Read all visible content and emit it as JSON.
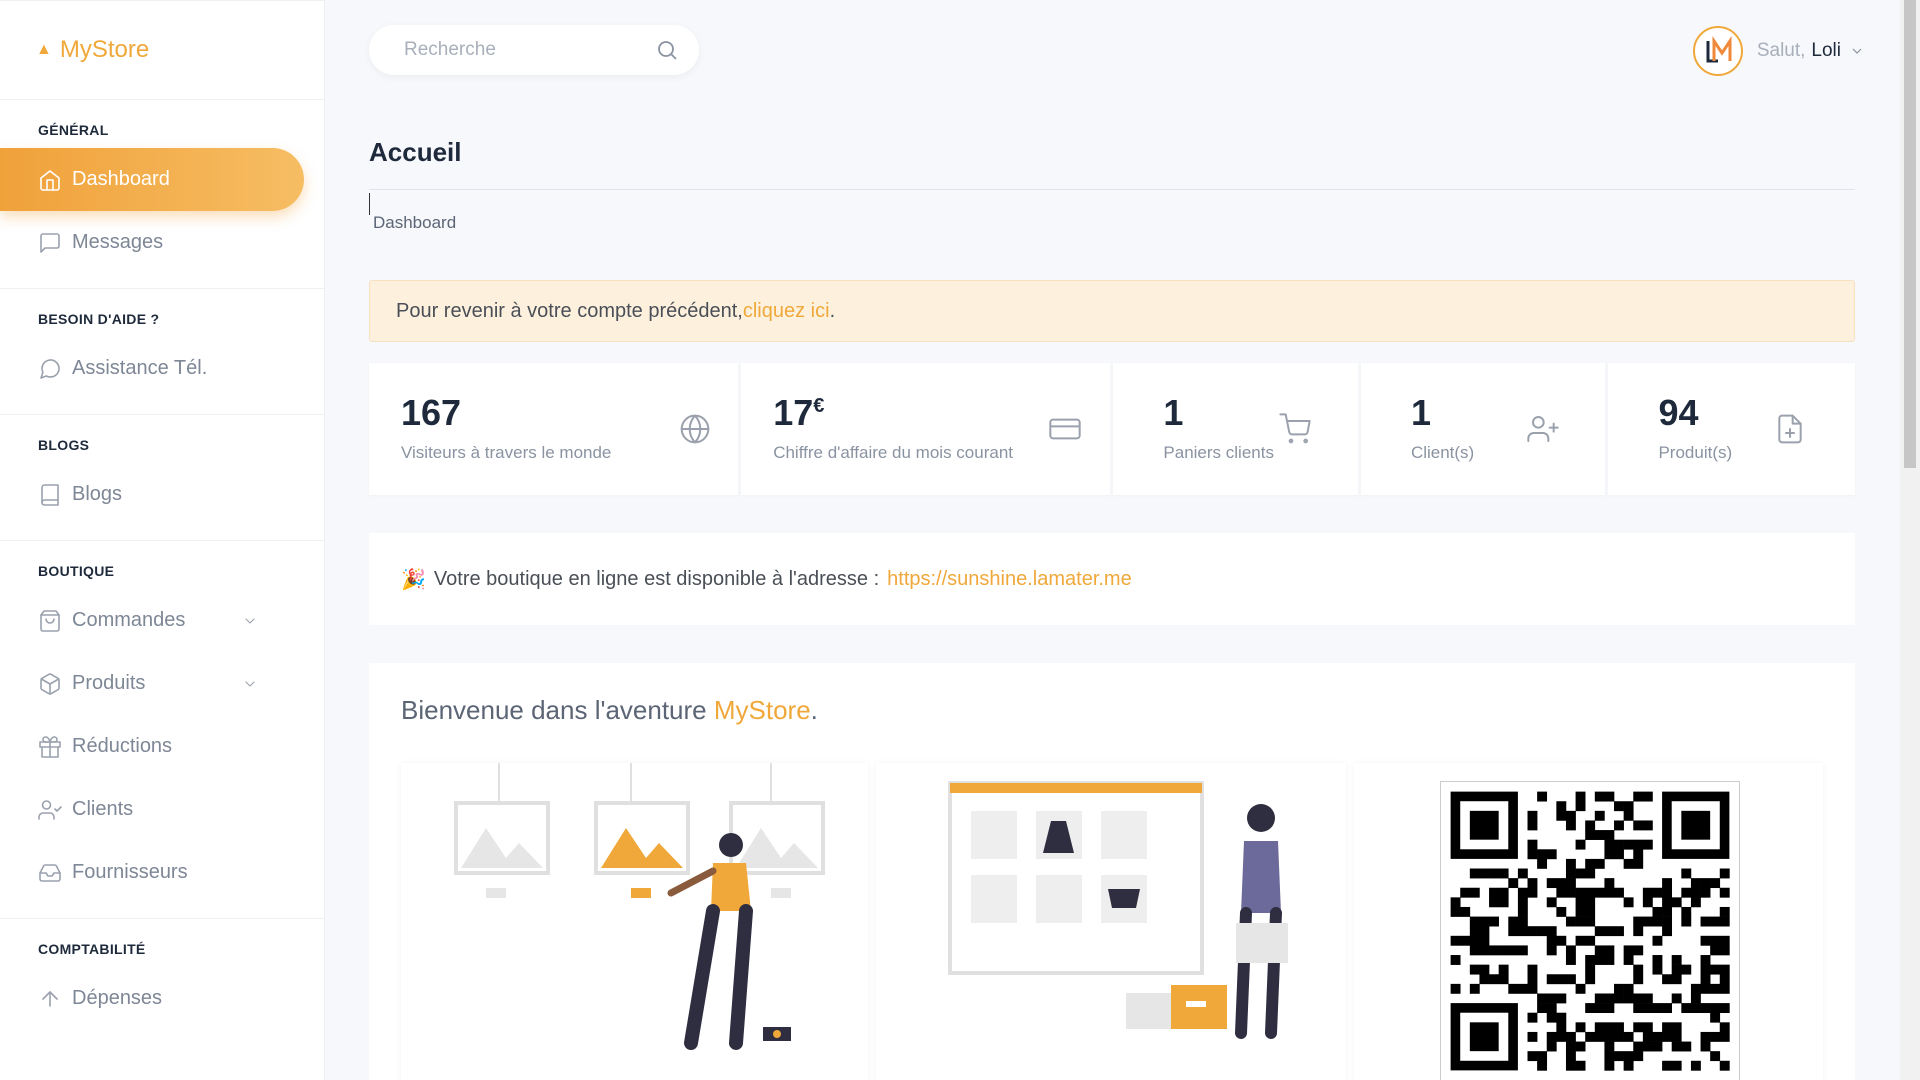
{
  "app": {
    "brand": "MyStore"
  },
  "sidebar": {
    "sections": [
      {
        "title": "GÉNÉRAL",
        "items": [
          {
            "label": "Dashboard",
            "icon": "home-icon",
            "active": true
          },
          {
            "label": "Messages",
            "icon": "message-icon"
          }
        ]
      },
      {
        "title": "BESOIN D'AIDE ?",
        "items": [
          {
            "label": "Assistance Tél.",
            "icon": "chat-bubble-icon"
          }
        ]
      },
      {
        "title": "BLOGS",
        "items": [
          {
            "label": "Blogs",
            "icon": "book-icon"
          }
        ]
      },
      {
        "title": "BOUTIQUE",
        "items": [
          {
            "label": "Commandes",
            "icon": "shopping-bag-icon",
            "expandable": true
          },
          {
            "label": "Produits",
            "icon": "box-icon",
            "expandable": true
          },
          {
            "label": "Réductions",
            "icon": "gift-icon"
          },
          {
            "label": "Clients",
            "icon": "user-check-icon"
          },
          {
            "label": "Fournisseurs",
            "icon": "inbox-icon"
          }
        ]
      },
      {
        "title": "COMPTABILITÉ",
        "items": [
          {
            "label": "Dépenses",
            "icon": "arrow-up-icon"
          }
        ]
      }
    ]
  },
  "header": {
    "search_placeholder": "Recherche",
    "greeting": "Salut,",
    "user_name": "Loli",
    "avatar_initials": "LM"
  },
  "main": {
    "title": "Accueil",
    "breadcrumb": "Dashboard",
    "alert": {
      "text": "Pour revenir à votre compte précédent, ",
      "link": "cliquez ici",
      "suffix": "."
    },
    "stats": [
      {
        "value": "167",
        "label": "Visiteurs à travers le monde",
        "icon": "globe-icon"
      },
      {
        "value": "17",
        "unit": "€",
        "label": "Chiffre d'affaire du mois courant",
        "icon": "credit-card-icon"
      },
      {
        "value": "1",
        "label": "Paniers clients",
        "icon": "cart-icon"
      },
      {
        "value": "1",
        "label": "Client(s)",
        "icon": "user-plus-icon"
      },
      {
        "value": "94",
        "label": "Produit(s)",
        "icon": "file-plus-icon"
      }
    ],
    "shop": {
      "text": "Votre boutique en ligne est disponible à l'adresse :",
      "url": "https://sunshine.lamater.me"
    },
    "welcome": {
      "text": "Bienvenue dans l'aventure ",
      "brand": "MyStore",
      "suffix": "."
    }
  },
  "colors": {
    "accent": "#f0a83a",
    "text": "#1e2a3b",
    "muted": "#8a93a1"
  }
}
